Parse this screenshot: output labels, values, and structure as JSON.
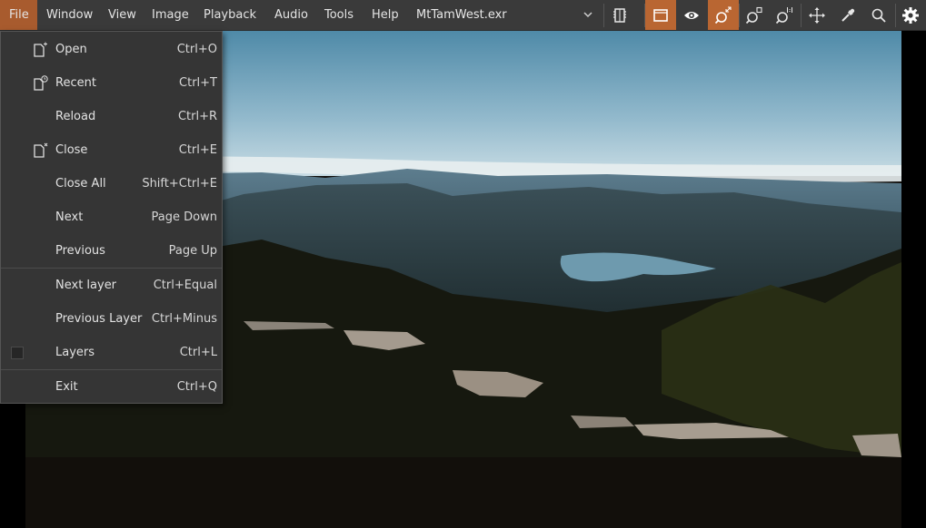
{
  "menubar": {
    "items": [
      "File",
      "Window",
      "View",
      "Image",
      "Playback",
      "Audio",
      "Tools",
      "Help"
    ],
    "active": "File"
  },
  "file_selector": {
    "value": "MtTamWest.exr"
  },
  "toolbar": {
    "buttons": [
      {
        "icon": "compare-icon",
        "active": false
      },
      {
        "icon": "frame-icon",
        "active": true
      },
      {
        "icon": "eye-icon",
        "active": false
      },
      {
        "icon": "zoom-fit-icon",
        "active": true
      },
      {
        "icon": "zoom-box-icon",
        "active": false
      },
      {
        "icon": "zoom-one-to-one-icon",
        "active": false
      },
      {
        "icon": "move-icon",
        "active": false
      },
      {
        "icon": "eyedropper-icon",
        "active": false
      },
      {
        "icon": "search-icon",
        "active": false
      },
      {
        "icon": "gear-icon",
        "active": false
      }
    ],
    "active_color": "#b96632"
  },
  "file_menu": {
    "items": [
      {
        "label": "Open",
        "shortcut": "Ctrl+O",
        "icon": "file-new-icon"
      },
      {
        "label": "Recent",
        "shortcut": "Ctrl+T",
        "icon": "file-recent-icon"
      },
      {
        "label": "Reload",
        "shortcut": "Ctrl+R",
        "icon": ""
      },
      {
        "label": "Close",
        "shortcut": "Ctrl+E",
        "icon": "file-close-icon"
      },
      {
        "label": "Close All",
        "shortcut": "Shift+Ctrl+E",
        "icon": ""
      },
      {
        "label": "Next",
        "shortcut": "Page Down",
        "icon": ""
      },
      {
        "label": "Previous",
        "shortcut": "Page Up",
        "icon": ""
      },
      {
        "label": "Next layer",
        "shortcut": "Ctrl+Equal",
        "icon": ""
      },
      {
        "label": "Previous Layer",
        "shortcut": "Ctrl+Minus",
        "icon": ""
      },
      {
        "label": "Layers",
        "shortcut": "Ctrl+L",
        "icon": "checkbox",
        "checked": false
      },
      {
        "label": "Exit",
        "shortcut": "Ctrl+Q",
        "icon": ""
      }
    ]
  },
  "colors": {
    "accent": "#a85b2e",
    "menu_bg": "#353535",
    "bar_bg": "#3a3a3a"
  }
}
